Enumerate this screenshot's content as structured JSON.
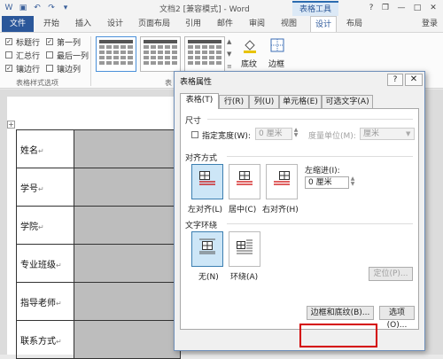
{
  "titlebar": {
    "doc_title": "文档2 [兼容模式] - Word",
    "tools_label": "表格工具",
    "min": "—",
    "max": "□",
    "close": "✕",
    "help": "?",
    "restore": "❐"
  },
  "tabs": {
    "file": "文件",
    "home": "开始",
    "insert": "插入",
    "design_doc": "设计",
    "layout_page": "页面布局",
    "references": "引用",
    "mailings": "邮件",
    "review": "审阅",
    "view": "视图",
    "design": "设计",
    "layout": "布局",
    "login": "登录"
  },
  "ribbon": {
    "options": [
      {
        "label": "标题行",
        "checked": true
      },
      {
        "label": "第一列",
        "checked": true
      },
      {
        "label": "汇总行",
        "checked": false
      },
      {
        "label": "最后一列",
        "checked": false
      },
      {
        "label": "镶边行",
        "checked": true
      },
      {
        "label": "镶边列",
        "checked": false
      }
    ],
    "options_group_label": "表格样式选项",
    "styles_group_label": "表",
    "shading_label": "底纹",
    "borders_label": "边框"
  },
  "document": {
    "rows": [
      "姓名",
      "学号",
      "学院",
      "专业班级",
      "指导老师",
      "联系方式"
    ],
    "para_mark": "↵",
    "move_handle": "+"
  },
  "dialog": {
    "title": "表格属性",
    "help": "?",
    "close": "✕",
    "tabs": [
      "表格(T)",
      "行(R)",
      "列(U)",
      "单元格(E)",
      "可选文字(A)"
    ],
    "size_section": "尺寸",
    "specify_width": "指定宽度(W):",
    "width_value": "0 厘米",
    "measure_in": "度量单位(M):",
    "measure_value": "厘米",
    "alignment_section": "对齐方式",
    "align_left": "左对齐(L)",
    "align_center": "居中(C)",
    "align_right": "右对齐(H)",
    "indent_label": "左缩进(I):",
    "indent_value": "0 厘米",
    "wrap_section": "文字环绕",
    "wrap_none": "无(N)",
    "wrap_around": "环绕(A)",
    "position_button": "定位(P)...",
    "borders_button": "边框和底纹(B)...",
    "options_button": "选项(O)..."
  },
  "colors": {
    "accent": "#2b579a",
    "highlight": "#d40000",
    "cell_fill": "#bdbdbd"
  }
}
